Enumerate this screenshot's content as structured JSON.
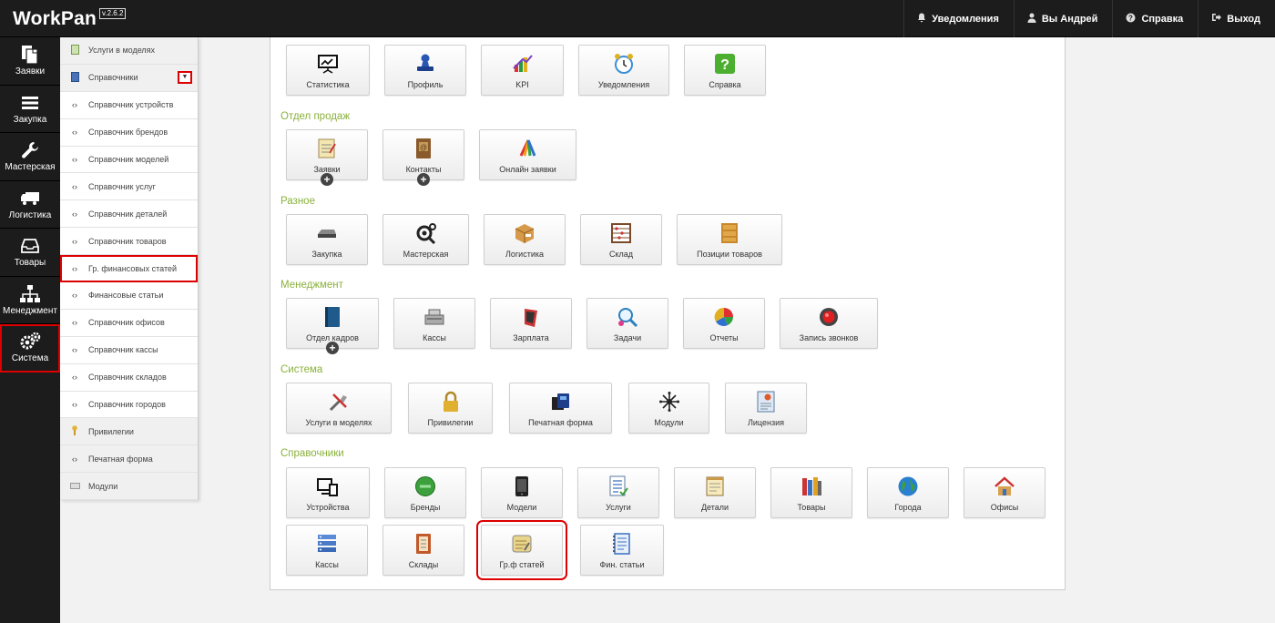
{
  "header": {
    "logo": "WorkPan",
    "version": "v.2.6.2",
    "nav": [
      {
        "label": "Уведомления",
        "icon": "bell-icon"
      },
      {
        "label": "Вы Андрей",
        "icon": "user-icon"
      },
      {
        "label": "Справка",
        "icon": "question-icon"
      },
      {
        "label": "Выход",
        "icon": "exit-icon"
      }
    ]
  },
  "leftbar": [
    {
      "label": "Заявки",
      "icon": "documents-icon"
    },
    {
      "label": "Закупка",
      "icon": "list-icon"
    },
    {
      "label": "Мастерская",
      "icon": "wrench-icon"
    },
    {
      "label": "Логистика",
      "icon": "truck-icon"
    },
    {
      "label": "Товары",
      "icon": "inbox-icon"
    },
    {
      "label": "Менеджмент",
      "icon": "sitemap-icon"
    },
    {
      "label": "Система",
      "icon": "gears-icon",
      "active": true
    }
  ],
  "submenu": [
    {
      "label": "Услуги в моделях",
      "icon": "book-icon"
    },
    {
      "label": "Справочники",
      "icon": "book-icon"
    },
    {
      "label": "Справочник устройств",
      "icon": "code-icon"
    },
    {
      "label": "Справочник брендов",
      "icon": "code-icon"
    },
    {
      "label": "Справочник моделей",
      "icon": "code-icon"
    },
    {
      "label": "Справочник услуг",
      "icon": "code-icon"
    },
    {
      "label": "Справочник деталей",
      "icon": "code-icon"
    },
    {
      "label": "Справочник товаров",
      "icon": "code-icon"
    },
    {
      "label": "Гр. финансовых статей",
      "icon": "code-icon"
    },
    {
      "label": "Финансовые статьи",
      "icon": "code-icon"
    },
    {
      "label": "Справочник офисов",
      "icon": "code-icon"
    },
    {
      "label": "Справочник кассы",
      "icon": "code-icon"
    },
    {
      "label": "Справочник складов",
      "icon": "code-icon"
    },
    {
      "label": "Справочник городов",
      "icon": "code-icon"
    },
    {
      "label": "Привилегии",
      "icon": "key-icon"
    },
    {
      "label": "Печатная форма",
      "icon": "code-icon"
    },
    {
      "label": "Модули",
      "icon": "keyboard-icon"
    }
  ],
  "main": {
    "top_tiles": [
      "Статистика",
      "Профиль",
      "KPI",
      "Уведомления",
      "Справка"
    ],
    "sections": {
      "sales": {
        "title": "Отдел продаж",
        "tiles": [
          "Заявки",
          "Контакты",
          "Онлайн заявки"
        ]
      },
      "misc": {
        "title": "Разное",
        "tiles": [
          "Закупка",
          "Мастерская",
          "Логистика",
          "Склад",
          "Позиции товаров"
        ]
      },
      "management": {
        "title": "Менеджмент",
        "tiles": [
          "Отдел кадров",
          "Кассы",
          "Зарплата",
          "Задачи",
          "Отчеты",
          "Запись звонков"
        ]
      },
      "system": {
        "title": "Система",
        "tiles": [
          "Услуги в моделях",
          "Привилегии",
          "Печатная форма",
          "Модули",
          "Лицензия"
        ]
      },
      "directories": {
        "title": "Справочники",
        "tiles": [
          "Устройства",
          "Бренды",
          "Модели",
          "Услуги",
          "Детали",
          "Товары",
          "Города",
          "Офисы",
          "Кассы",
          "Склады",
          "Гр.ф статей",
          "Фин. статьи"
        ]
      }
    }
  }
}
